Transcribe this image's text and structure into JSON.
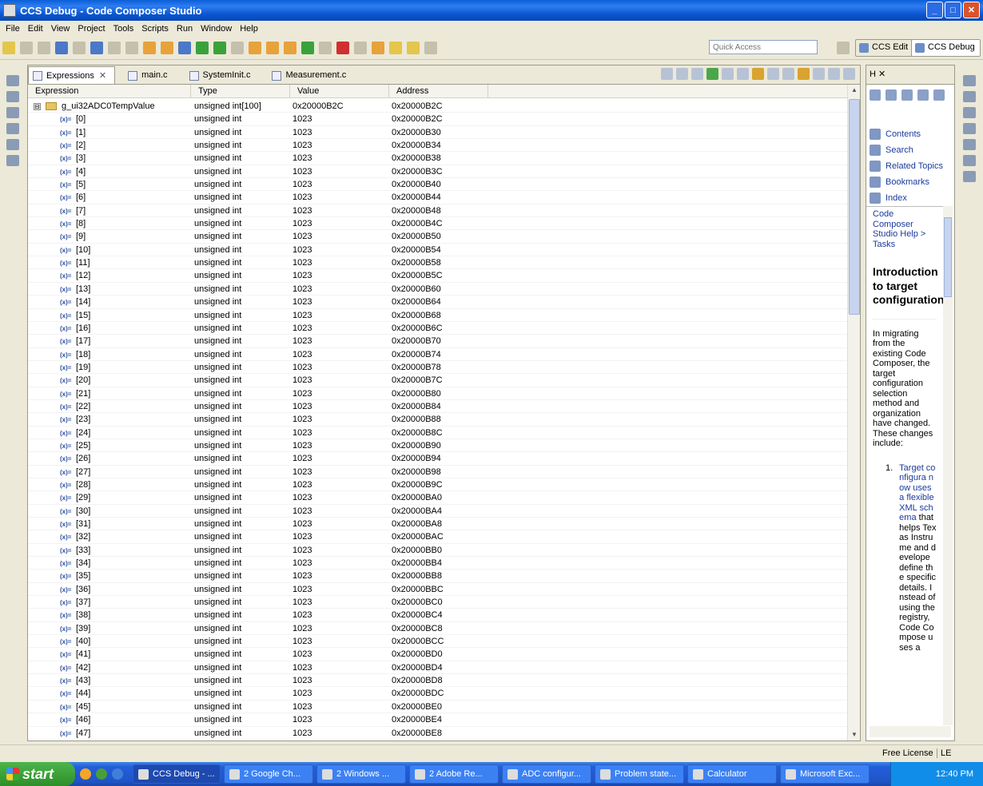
{
  "window": {
    "title": "CCS Debug - Code Composer Studio",
    "buttons": [
      "_",
      "□",
      "✕"
    ]
  },
  "menu": [
    "File",
    "Edit",
    "View",
    "Project",
    "Tools",
    "Scripts",
    "Run",
    "Window",
    "Help"
  ],
  "quick_access": {
    "placeholder": "Quick Access"
  },
  "perspectives": [
    {
      "label": "CCS Edit",
      "active": false
    },
    {
      "label": "CCS Debug",
      "active": true
    }
  ],
  "tabs": [
    {
      "label": "Expressions",
      "close": "✕",
      "icon": "expressions-icon"
    },
    {
      "label": "main.c",
      "icon": "c-file-icon"
    },
    {
      "label": "SystemInit.c",
      "icon": "c-file-icon"
    },
    {
      "label": "Measurement.c",
      "icon": "c-file-icon"
    }
  ],
  "columns": [
    "Expression",
    "Type",
    "Value",
    "Address"
  ],
  "root": {
    "expression": "g_ui32ADC0TempValue",
    "type": "unsigned int[100]",
    "value": "0x20000B2C",
    "address": "0x20000B2C",
    "toggle": "⊟"
  },
  "rows": [
    {
      "expression": "[0]",
      "type": "unsigned int",
      "value": "1023",
      "address": "0x20000B2C"
    },
    {
      "expression": "[1]",
      "type": "unsigned int",
      "value": "1023",
      "address": "0x20000B30"
    },
    {
      "expression": "[2]",
      "type": "unsigned int",
      "value": "1023",
      "address": "0x20000B34"
    },
    {
      "expression": "[3]",
      "type": "unsigned int",
      "value": "1023",
      "address": "0x20000B38"
    },
    {
      "expression": "[4]",
      "type": "unsigned int",
      "value": "1023",
      "address": "0x20000B3C"
    },
    {
      "expression": "[5]",
      "type": "unsigned int",
      "value": "1023",
      "address": "0x20000B40"
    },
    {
      "expression": "[6]",
      "type": "unsigned int",
      "value": "1023",
      "address": "0x20000B44"
    },
    {
      "expression": "[7]",
      "type": "unsigned int",
      "value": "1023",
      "address": "0x20000B48"
    },
    {
      "expression": "[8]",
      "type": "unsigned int",
      "value": "1023",
      "address": "0x20000B4C"
    },
    {
      "expression": "[9]",
      "type": "unsigned int",
      "value": "1023",
      "address": "0x20000B50"
    },
    {
      "expression": "[10]",
      "type": "unsigned int",
      "value": "1023",
      "address": "0x20000B54"
    },
    {
      "expression": "[11]",
      "type": "unsigned int",
      "value": "1023",
      "address": "0x20000B58"
    },
    {
      "expression": "[12]",
      "type": "unsigned int",
      "value": "1023",
      "address": "0x20000B5C"
    },
    {
      "expression": "[13]",
      "type": "unsigned int",
      "value": "1023",
      "address": "0x20000B60"
    },
    {
      "expression": "[14]",
      "type": "unsigned int",
      "value": "1023",
      "address": "0x20000B64"
    },
    {
      "expression": "[15]",
      "type": "unsigned int",
      "value": "1023",
      "address": "0x20000B68"
    },
    {
      "expression": "[16]",
      "type": "unsigned int",
      "value": "1023",
      "address": "0x20000B6C"
    },
    {
      "expression": "[17]",
      "type": "unsigned int",
      "value": "1023",
      "address": "0x20000B70"
    },
    {
      "expression": "[18]",
      "type": "unsigned int",
      "value": "1023",
      "address": "0x20000B74"
    },
    {
      "expression": "[19]",
      "type": "unsigned int",
      "value": "1023",
      "address": "0x20000B78"
    },
    {
      "expression": "[20]",
      "type": "unsigned int",
      "value": "1023",
      "address": "0x20000B7C"
    },
    {
      "expression": "[21]",
      "type": "unsigned int",
      "value": "1023",
      "address": "0x20000B80"
    },
    {
      "expression": "[22]",
      "type": "unsigned int",
      "value": "1023",
      "address": "0x20000B84"
    },
    {
      "expression": "[23]",
      "type": "unsigned int",
      "value": "1023",
      "address": "0x20000B88"
    },
    {
      "expression": "[24]",
      "type": "unsigned int",
      "value": "1023",
      "address": "0x20000B8C"
    },
    {
      "expression": "[25]",
      "type": "unsigned int",
      "value": "1023",
      "address": "0x20000B90"
    },
    {
      "expression": "[26]",
      "type": "unsigned int",
      "value": "1023",
      "address": "0x20000B94"
    },
    {
      "expression": "[27]",
      "type": "unsigned int",
      "value": "1023",
      "address": "0x20000B98"
    },
    {
      "expression": "[28]",
      "type": "unsigned int",
      "value": "1023",
      "address": "0x20000B9C"
    },
    {
      "expression": "[29]",
      "type": "unsigned int",
      "value": "1023",
      "address": "0x20000BA0"
    },
    {
      "expression": "[30]",
      "type": "unsigned int",
      "value": "1023",
      "address": "0x20000BA4"
    },
    {
      "expression": "[31]",
      "type": "unsigned int",
      "value": "1023",
      "address": "0x20000BA8"
    },
    {
      "expression": "[32]",
      "type": "unsigned int",
      "value": "1023",
      "address": "0x20000BAC"
    },
    {
      "expression": "[33]",
      "type": "unsigned int",
      "value": "1023",
      "address": "0x20000BB0"
    },
    {
      "expression": "[34]",
      "type": "unsigned int",
      "value": "1023",
      "address": "0x20000BB4"
    },
    {
      "expression": "[35]",
      "type": "unsigned int",
      "value": "1023",
      "address": "0x20000BB8"
    },
    {
      "expression": "[36]",
      "type": "unsigned int",
      "value": "1023",
      "address": "0x20000BBC"
    },
    {
      "expression": "[37]",
      "type": "unsigned int",
      "value": "1023",
      "address": "0x20000BC0"
    },
    {
      "expression": "[38]",
      "type": "unsigned int",
      "value": "1023",
      "address": "0x20000BC4"
    },
    {
      "expression": "[39]",
      "type": "unsigned int",
      "value": "1023",
      "address": "0x20000BC8"
    },
    {
      "expression": "[40]",
      "type": "unsigned int",
      "value": "1023",
      "address": "0x20000BCC"
    },
    {
      "expression": "[41]",
      "type": "unsigned int",
      "value": "1023",
      "address": "0x20000BD0"
    },
    {
      "expression": "[42]",
      "type": "unsigned int",
      "value": "1023",
      "address": "0x20000BD4"
    },
    {
      "expression": "[43]",
      "type": "unsigned int",
      "value": "1023",
      "address": "0x20000BD8"
    },
    {
      "expression": "[44]",
      "type": "unsigned int",
      "value": "1023",
      "address": "0x20000BDC"
    },
    {
      "expression": "[45]",
      "type": "unsigned int",
      "value": "1023",
      "address": "0x20000BE0"
    },
    {
      "expression": "[46]",
      "type": "unsigned int",
      "value": "1023",
      "address": "0x20000BE4"
    },
    {
      "expression": "[47]",
      "type": "unsigned int",
      "value": "1023",
      "address": "0x20000BE8"
    }
  ],
  "help": {
    "tab_label": "H",
    "tab_close": "✕",
    "links": [
      "Contents",
      "Search",
      "Related Topics",
      "Bookmarks",
      "Index"
    ],
    "breadcrumb": "Code Composer Studio Help > Tasks",
    "title": "Introduction to target configuration",
    "paragraph": "In migrating from the existing Code Composer, the target configuration selection method and organization have changed. These changes include:",
    "list_number": "1.",
    "list_link": "Target configura now uses a flexible XML schema",
    "list_text": "that helps Texas Instrume and develope define the specific details. Instead of using the registry, Code Compose uses a"
  },
  "status": {
    "license": "Free License",
    "mode": "LE"
  },
  "taskbar": {
    "start": "start",
    "tasks": [
      "CCS Debug - ...",
      "2 Google Ch...",
      "2 Windows ...",
      "2 Adobe Re...",
      "ADC configur...",
      "Problem state...",
      "Calculator",
      "Microsoft Exc..."
    ],
    "clock": "12:40 PM"
  }
}
